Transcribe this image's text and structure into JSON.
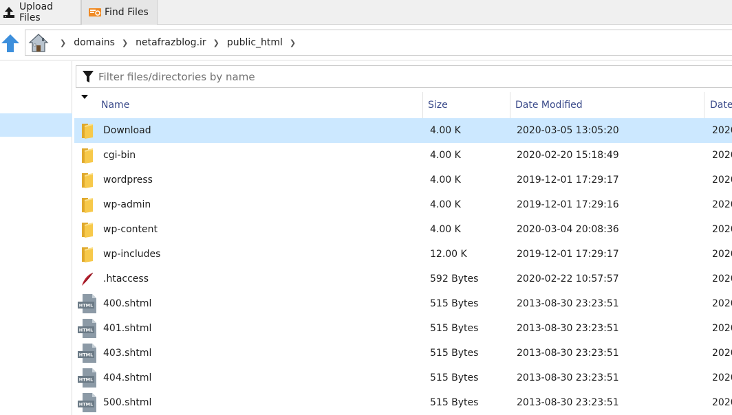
{
  "toolbar": {
    "upload_label": "Upload Files",
    "find_label": "Find Files",
    "upload_icon": "upload-icon",
    "find_icon": "find-files-icon"
  },
  "breadcrumb": {
    "up_icon": "up-arrow-icon",
    "home_icon": "home-icon",
    "items": [
      "domains",
      "netafrazblog.ir",
      "public_html"
    ]
  },
  "filter": {
    "placeholder": "Filter files/directories by name",
    "value": ""
  },
  "table": {
    "columns": {
      "name": "Name",
      "size": "Size",
      "date_modified": "Date Modified",
      "date_extra": "Date"
    },
    "rows": [
      {
        "icon": "folder-icon",
        "name": "Download",
        "size": "4.00 K",
        "modified": "2020-03-05 13:05:20",
        "extra": "2020",
        "selected": true
      },
      {
        "icon": "folder-icon",
        "name": "cgi-bin",
        "size": "4.00 K",
        "modified": "2020-02-20 15:18:49",
        "extra": "2020"
      },
      {
        "icon": "folder-icon",
        "name": "wordpress",
        "size": "4.00 K",
        "modified": "2019-12-01 17:29:17",
        "extra": "2020"
      },
      {
        "icon": "folder-icon",
        "name": "wp-admin",
        "size": "4.00 K",
        "modified": "2019-12-01 17:29:16",
        "extra": "2020"
      },
      {
        "icon": "folder-icon",
        "name": "wp-content",
        "size": "4.00 K",
        "modified": "2020-03-04 20:08:36",
        "extra": "2020"
      },
      {
        "icon": "folder-icon",
        "name": "wp-includes",
        "size": "12.00 K",
        "modified": "2019-12-01 17:29:17",
        "extra": "2020"
      },
      {
        "icon": "feather-icon",
        "name": ".htaccess",
        "size": "592 Bytes",
        "modified": "2020-02-22 10:57:57",
        "extra": "2020"
      },
      {
        "icon": "html-file-icon",
        "name": "400.shtml",
        "size": "515 Bytes",
        "modified": "2013-08-30 23:23:51",
        "extra": "2020"
      },
      {
        "icon": "html-file-icon",
        "name": "401.shtml",
        "size": "515 Bytes",
        "modified": "2013-08-30 23:23:51",
        "extra": "2020"
      },
      {
        "icon": "html-file-icon",
        "name": "403.shtml",
        "size": "515 Bytes",
        "modified": "2013-08-30 23:23:51",
        "extra": "2020"
      },
      {
        "icon": "html-file-icon",
        "name": "404.shtml",
        "size": "515 Bytes",
        "modified": "2013-08-30 23:23:51",
        "extra": "2020"
      },
      {
        "icon": "html-file-icon",
        "name": "500.shtml",
        "size": "515 Bytes",
        "modified": "2013-08-30 23:23:51",
        "extra": "2020"
      }
    ]
  },
  "file_icon_label": "HTML",
  "colors": {
    "selection": "#cce8ff",
    "header_text": "#3a4a8a",
    "folder": "#f7c94b",
    "up_arrow": "#3d8fdc"
  }
}
